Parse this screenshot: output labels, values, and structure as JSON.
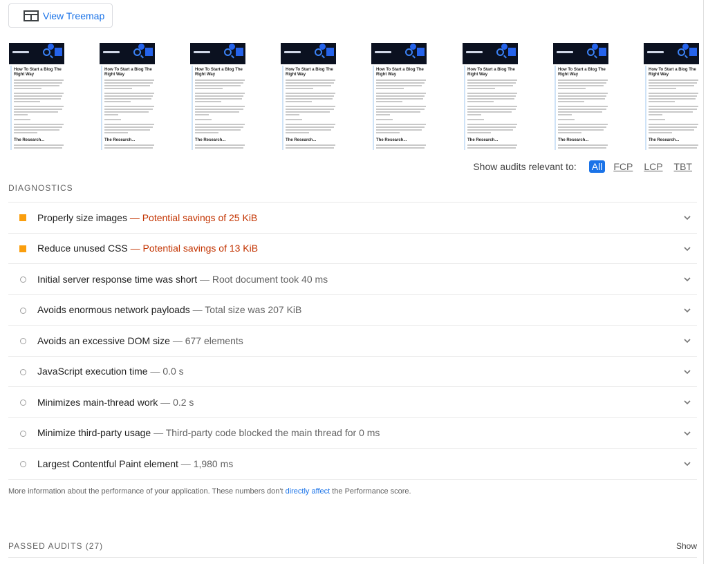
{
  "treemap_button": {
    "label": "View Treemap",
    "icon": "treemap-icon"
  },
  "filmstrip": {
    "frames": [
      {
        "heading": "How To Start a Blog The Right Way",
        "subheading": "The Research..."
      },
      {
        "heading": "How To Start a Blog The Right Way",
        "subheading": "The Research..."
      },
      {
        "heading": "How To Start a Blog The Right Way",
        "subheading": "The Research..."
      },
      {
        "heading": "How To Start a Blog The Right Way",
        "subheading": "The Research..."
      },
      {
        "heading": "How To Start a Blog The Right Way",
        "subheading": "The Research..."
      },
      {
        "heading": "How To Start a Blog The Right Way",
        "subheading": "The Research..."
      },
      {
        "heading": "How To Start a Blog The Right Way",
        "subheading": "The Research..."
      },
      {
        "heading": "How To Start a Blog The Right Way",
        "subheading": "The Research..."
      }
    ]
  },
  "filters": {
    "lead": "Show audits relevant to:",
    "options": [
      "All",
      "FCP",
      "LCP",
      "TBT"
    ],
    "active": "All"
  },
  "diagnostics": {
    "title": "DIAGNOSTICS",
    "audits": [
      {
        "title": "Properly size images",
        "separator": "—",
        "display": "Potential savings of 25 KiB",
        "status": "warn"
      },
      {
        "title": "Reduce unused CSS",
        "separator": "—",
        "display": "Potential savings of 13 KiB",
        "status": "warn"
      },
      {
        "title": "Initial server response time was short",
        "separator": "—",
        "display": "Root document took 40 ms",
        "status": "info"
      },
      {
        "title": "Avoids enormous network payloads",
        "separator": "—",
        "display": "Total size was 207 KiB",
        "status": "info"
      },
      {
        "title": "Avoids an excessive DOM size",
        "separator": "—",
        "display": "677 elements",
        "status": "info"
      },
      {
        "title": "JavaScript execution time",
        "separator": "—",
        "display": "0.0 s",
        "status": "info"
      },
      {
        "title": "Minimizes main-thread work",
        "separator": "—",
        "display": "0.2 s",
        "status": "info"
      },
      {
        "title": "Minimize third-party usage",
        "separator": "—",
        "display": "Third-party code blocked the main thread for 0 ms",
        "status": "info"
      },
      {
        "title": "Largest Contentful Paint element",
        "separator": "—",
        "display": "1,980 ms",
        "status": "info"
      }
    ],
    "note_before": "More information about the performance of your application. These numbers don't ",
    "note_link": "directly affect",
    "note_after": " the Performance score."
  },
  "passed_audits": {
    "title": "PASSED AUDITS (27)",
    "toggle": "Show"
  },
  "colors": {
    "accent": "#1a73e8",
    "warn": "#fa9e0d",
    "warn_text": "#c33300",
    "neutral_marker": "#9e9e9e"
  }
}
